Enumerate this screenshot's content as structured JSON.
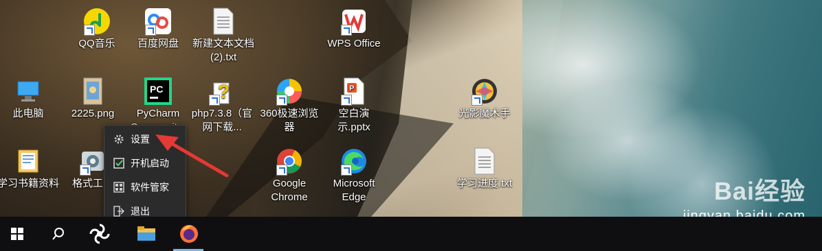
{
  "desktop": {
    "icons": [
      {
        "label": "QQ音乐"
      },
      {
        "label": "百度网盘"
      },
      {
        "label": "新建文本文档 (2).txt"
      },
      {
        "label": "WPS Office"
      },
      {
        "label": "此电脑"
      },
      {
        "label": "2225.png"
      },
      {
        "label": "PyCharm Communit..."
      },
      {
        "label": "php7.3.8（官网下载..."
      },
      {
        "label": "360极速浏览器"
      },
      {
        "label": "空白演示.pptx"
      },
      {
        "label": "光影魔术手"
      },
      {
        "label": "学习书籍资料"
      },
      {
        "label": "格式工厂"
      },
      {
        "label": "Google Chrome"
      },
      {
        "label": "Microsoft Edge"
      },
      {
        "label": "学习进度.txt"
      }
    ]
  },
  "context_menu": {
    "items": [
      {
        "label": "设置",
        "icon": "gear-icon"
      },
      {
        "label": "开机启动",
        "icon": "checkbox-icon"
      },
      {
        "label": "软件管家",
        "icon": "grid-icon"
      },
      {
        "label": "退出",
        "icon": "exit-icon"
      }
    ]
  },
  "taskbar": {
    "items": [
      {
        "name": "start-button",
        "icon": "windows-icon"
      },
      {
        "name": "search-button",
        "icon": "search-icon"
      },
      {
        "name": "app-button",
        "icon": "app-icon"
      },
      {
        "name": "file-explorer-button",
        "icon": "folder-icon"
      },
      {
        "name": "firefox-button",
        "icon": "firefox-icon"
      }
    ]
  },
  "watermark": {
    "logo": "Bai经验",
    "url": "jingyan.baidu.com"
  },
  "colors": {
    "menu_bg": "#2b2b2b",
    "taskbar_bg": "#0f0f12",
    "arrow": "#e53935",
    "active_indicator": "#7fb3e8"
  }
}
